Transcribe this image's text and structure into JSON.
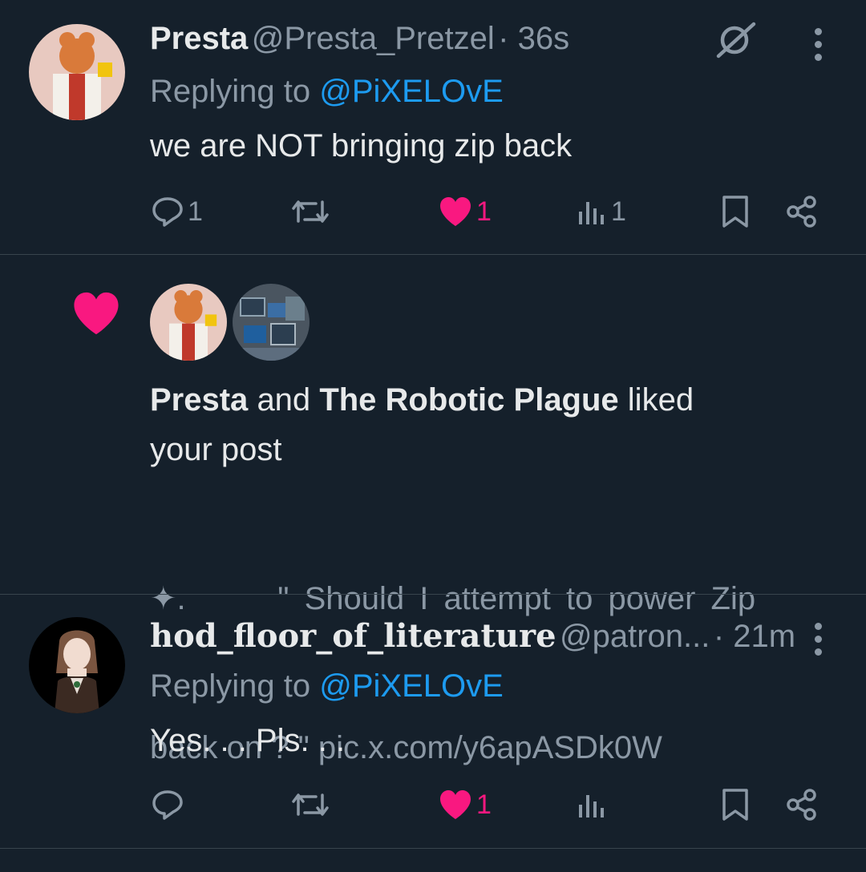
{
  "post1": {
    "display_name": "Presta",
    "handle": "@Presta_Pretzel",
    "time": "· 36s",
    "replying_prefix": "Replying to",
    "replying_handle": "@PiXELOvE",
    "text": "we are NOT bringing zip back",
    "replies": "1",
    "likes": "1",
    "views": "1",
    "grok_icon": "grok-icon",
    "more_icon": "more-vertical-icon"
  },
  "notification": {
    "actor1": "Presta",
    "connector": "and",
    "actor2": "The Robotic Plague",
    "action_suffix": "liked",
    "action_suffix2": "your post",
    "quoted_line1": "✦.      \" Should I attempt to power Zip",
    "quoted_line2": "back on ? \" pic.x.com/y6apASDk0W",
    "heart_icon": "heart-icon"
  },
  "post2": {
    "display_name": "hod_floor_of_literature",
    "handle": "@patron...",
    "time": "· 21m",
    "replying_prefix": "Replying to",
    "replying_handle": "@PiXELOvE",
    "text": "Yes. . . Pls. . .",
    "likes": "1"
  },
  "colors": {
    "background": "#15202b",
    "link": "#1d9bf0",
    "like": "#f91880",
    "muted": "#8b98a5"
  }
}
